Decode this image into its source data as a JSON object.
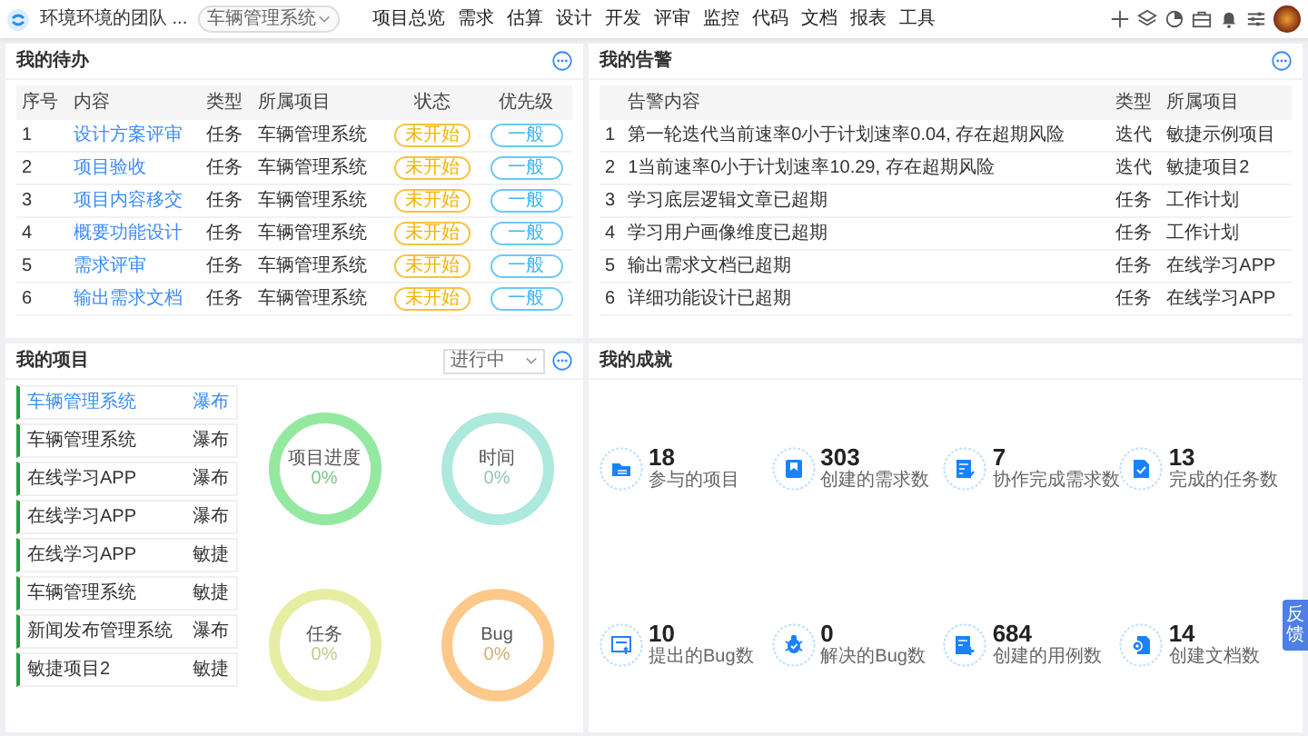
{
  "topbar": {
    "team": "环境环境的团队 ...",
    "project_select": "车辆管理系统",
    "nav": [
      {
        "label": "项目总览"
      },
      {
        "label": "需求"
      },
      {
        "label": "估算"
      },
      {
        "label": "设计"
      },
      {
        "label": "开发"
      },
      {
        "label": "评审"
      },
      {
        "label": "监控"
      },
      {
        "label": "代码"
      },
      {
        "label": "文档"
      },
      {
        "label": "报表"
      },
      {
        "label": "工具"
      }
    ]
  },
  "todo": {
    "title": "我的待办",
    "columns": [
      "序号",
      "内容",
      "类型",
      "所属项目",
      "状态",
      "优先级"
    ],
    "rows": [
      {
        "index": "1",
        "content": "设计方案评审",
        "type": "任务",
        "project": "车辆管理系统",
        "status": "未开始",
        "priority": "一般"
      },
      {
        "index": "2",
        "content": "项目验收",
        "type": "任务",
        "project": "车辆管理系统",
        "status": "未开始",
        "priority": "一般"
      },
      {
        "index": "3",
        "content": "项目内容移交",
        "type": "任务",
        "project": "车辆管理系统",
        "status": "未开始",
        "priority": "一般"
      },
      {
        "index": "4",
        "content": "概要功能设计",
        "type": "任务",
        "project": "车辆管理系统",
        "status": "未开始",
        "priority": "一般"
      },
      {
        "index": "5",
        "content": "需求评审",
        "type": "任务",
        "project": "车辆管理系统",
        "status": "未开始",
        "priority": "一般"
      },
      {
        "index": "6",
        "content": "输出需求文档",
        "type": "任务",
        "project": "车辆管理系统",
        "status": "未开始",
        "priority": "一般"
      }
    ]
  },
  "warnings": {
    "title": "我的告警",
    "columns": [
      "告警内容",
      "类型",
      "所属项目"
    ],
    "rows": [
      {
        "index": "1",
        "content": "第一轮迭代当前速率0小于计划速率0.04, 存在超期风险",
        "type": "迭代",
        "project": "敏捷示例项目"
      },
      {
        "index": "2",
        "content": "1当前速率0小于计划速率10.29, 存在超期风险",
        "type": "迭代",
        "project": "敏捷项目2"
      },
      {
        "index": "3",
        "content": "学习底层逻辑文章已超期",
        "type": "任务",
        "project": "工作计划"
      },
      {
        "index": "4",
        "content": "学习用户画像维度已超期",
        "type": "任务",
        "project": "工作计划"
      },
      {
        "index": "5",
        "content": "输出需求文档已超期",
        "type": "任务",
        "project": "在线学习APP"
      },
      {
        "index": "6",
        "content": "详细功能设计已超期",
        "type": "任务",
        "project": "在线学习APP"
      }
    ]
  },
  "projects": {
    "title": "我的项目",
    "filter": "进行中",
    "items": [
      {
        "name": "车辆管理系统",
        "method": "瀑布",
        "selected": true
      },
      {
        "name": "车辆管理系统",
        "method": "瀑布",
        "selected": false
      },
      {
        "name": "在线学习APP",
        "method": "瀑布",
        "selected": false
      },
      {
        "name": "在线学习APP",
        "method": "瀑布",
        "selected": false
      },
      {
        "name": "在线学习APP",
        "method": "敏捷",
        "selected": false
      },
      {
        "name": "车辆管理系统",
        "method": "敏捷",
        "selected": false
      },
      {
        "name": "新闻发布管理系统",
        "method": "瀑布",
        "selected": false
      },
      {
        "name": "敏捷项目2",
        "method": "敏捷",
        "selected": false
      }
    ],
    "rings": [
      {
        "label": "项目进度",
        "value": "0%",
        "color": "#95e8a0"
      },
      {
        "label": "时间",
        "value": "0%",
        "color": "#ade9dc"
      },
      {
        "label": "任务",
        "value": "0%",
        "color": "#e6eea4"
      },
      {
        "label": "Bug",
        "value": "0%",
        "color": "#fdc98a"
      }
    ]
  },
  "achievements": {
    "title": "我的成就",
    "stats": [
      {
        "kind": "folder",
        "value": "18",
        "label": "参与的项目"
      },
      {
        "kind": "bookmark",
        "value": "303",
        "label": "创建的需求数"
      },
      {
        "kind": "checklist",
        "value": "7",
        "label": "协作完成需求数"
      },
      {
        "kind": "filecheck",
        "value": "13",
        "label": "完成的任务数"
      },
      {
        "kind": "bugreport",
        "value": "10",
        "label": "提出的Bug数"
      },
      {
        "kind": "bug",
        "value": "0",
        "label": "解决的Bug数"
      },
      {
        "kind": "addcase",
        "value": "684",
        "label": "创建的用例数"
      },
      {
        "kind": "document",
        "value": "14",
        "label": "创建文档数"
      }
    ]
  },
  "feedback_tab": "反馈"
}
